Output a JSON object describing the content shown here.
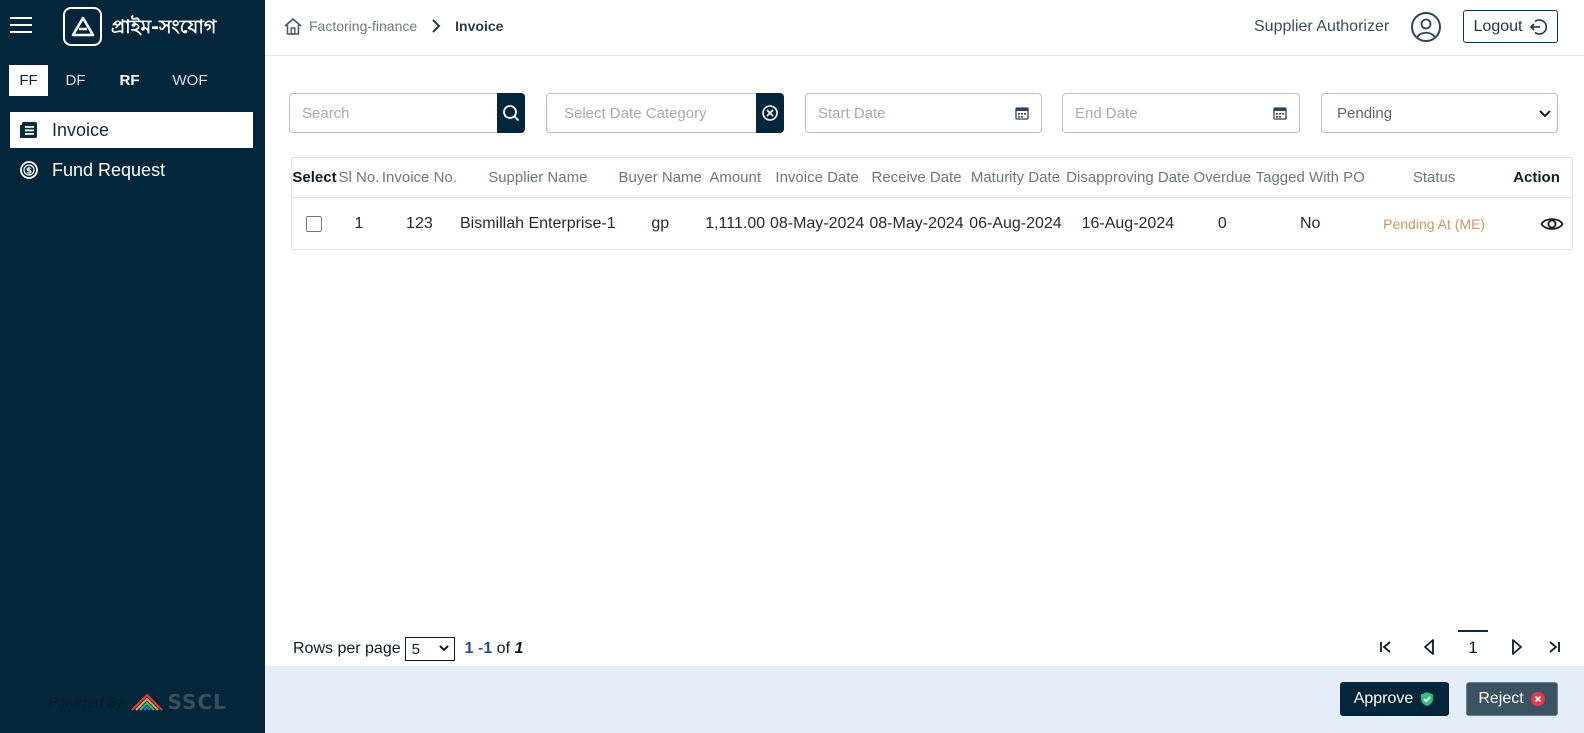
{
  "brand": {
    "name": "প্রাইম-সংযোগ"
  },
  "sidebar": {
    "tabs": [
      "FF",
      "DF",
      "RF",
      "WOF"
    ],
    "items": [
      {
        "label": "Invoice",
        "icon": "invoice-list-icon"
      },
      {
        "label": "Fund Request",
        "icon": "dollar-circle-icon"
      }
    ],
    "powered_by": "Powered By",
    "powered_brand": "SSCL"
  },
  "header": {
    "breadcrumb": {
      "parent": "Factoring-finance",
      "current": "Invoice"
    },
    "user_role": "Supplier Authorizer",
    "logout_label": "Logout"
  },
  "filters": {
    "search_placeholder": "Search",
    "date_category_placeholder": "Select Date Category",
    "start_date_placeholder": "Start Date",
    "end_date_placeholder": "End Date",
    "status_selected": "Pending"
  },
  "table": {
    "columns": [
      "Select",
      "Sl No.",
      "Invoice No.",
      "Supplier Name",
      "Buyer Name",
      "Amount",
      "Invoice Date",
      "Receive Date",
      "Maturity Date",
      "Disapproving Date",
      "Overdue",
      "Tagged With PO",
      "Status",
      "Action"
    ],
    "rows": [
      {
        "sl": "1",
        "invoice_no": "123",
        "supplier": "Bismillah Enterprise-1",
        "buyer": "gp",
        "amount": "1,111.00",
        "invoice_date": "08-May-2024",
        "receive_date": "08-May-2024",
        "maturity_date": "06-Aug-2024",
        "disapproving_date": "16-Aug-2024",
        "overdue": "0",
        "tagged_po": "No",
        "status": "Pending At (ME)"
      }
    ]
  },
  "pagination": {
    "rows_per_page_label": "Rows per page",
    "rows_per_page_value": "5",
    "range_start": "1",
    "range_sep": " -",
    "range_end": "1",
    "range_of": " of ",
    "total": "1",
    "current_page": "1"
  },
  "actions": {
    "approve_label": "Approve",
    "reject_label": "Reject"
  },
  "colors": {
    "sidebar_bg": "#04263b",
    "footer_bg": "#e3eef9",
    "status_pending": "#d19363",
    "approve_check": "#2ec27e",
    "reject_x": "#e53950"
  }
}
